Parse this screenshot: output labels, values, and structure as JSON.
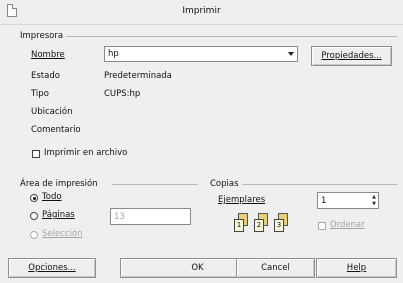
{
  "window": {
    "title": "Imprimir"
  },
  "printer": {
    "group_label": "Impresora",
    "name_label": "Nombre",
    "name_value": "hp",
    "properties_button": "Propiedades...",
    "status_label": "Estado",
    "status_value": "Predeterminada",
    "type_label": "Tipo",
    "type_value": "CUPS:hp",
    "location_label": "Ubicación",
    "location_value": "",
    "comment_label": "Comentario",
    "comment_value": "",
    "print_to_file_label": "Imprimir en archivo",
    "print_to_file_checked": false
  },
  "print_range": {
    "group_label": "Área de impresión",
    "options": [
      {
        "label": "Todo",
        "checked": true,
        "enabled": true
      },
      {
        "label": "Páginas",
        "checked": false,
        "enabled": true
      },
      {
        "label": "Selección",
        "checked": false,
        "enabled": false
      }
    ],
    "pages_value": "13"
  },
  "copies": {
    "group_label": "Copias",
    "copies_label": "Ejemplares",
    "copies_value": "1",
    "collate_label": "Ordenar",
    "collate_enabled": false,
    "collate_icons": [
      "1",
      "2",
      "3"
    ]
  },
  "buttons": {
    "options": "Opciones...",
    "ok": "OK",
    "cancel": "Cancel",
    "help": "Help"
  }
}
